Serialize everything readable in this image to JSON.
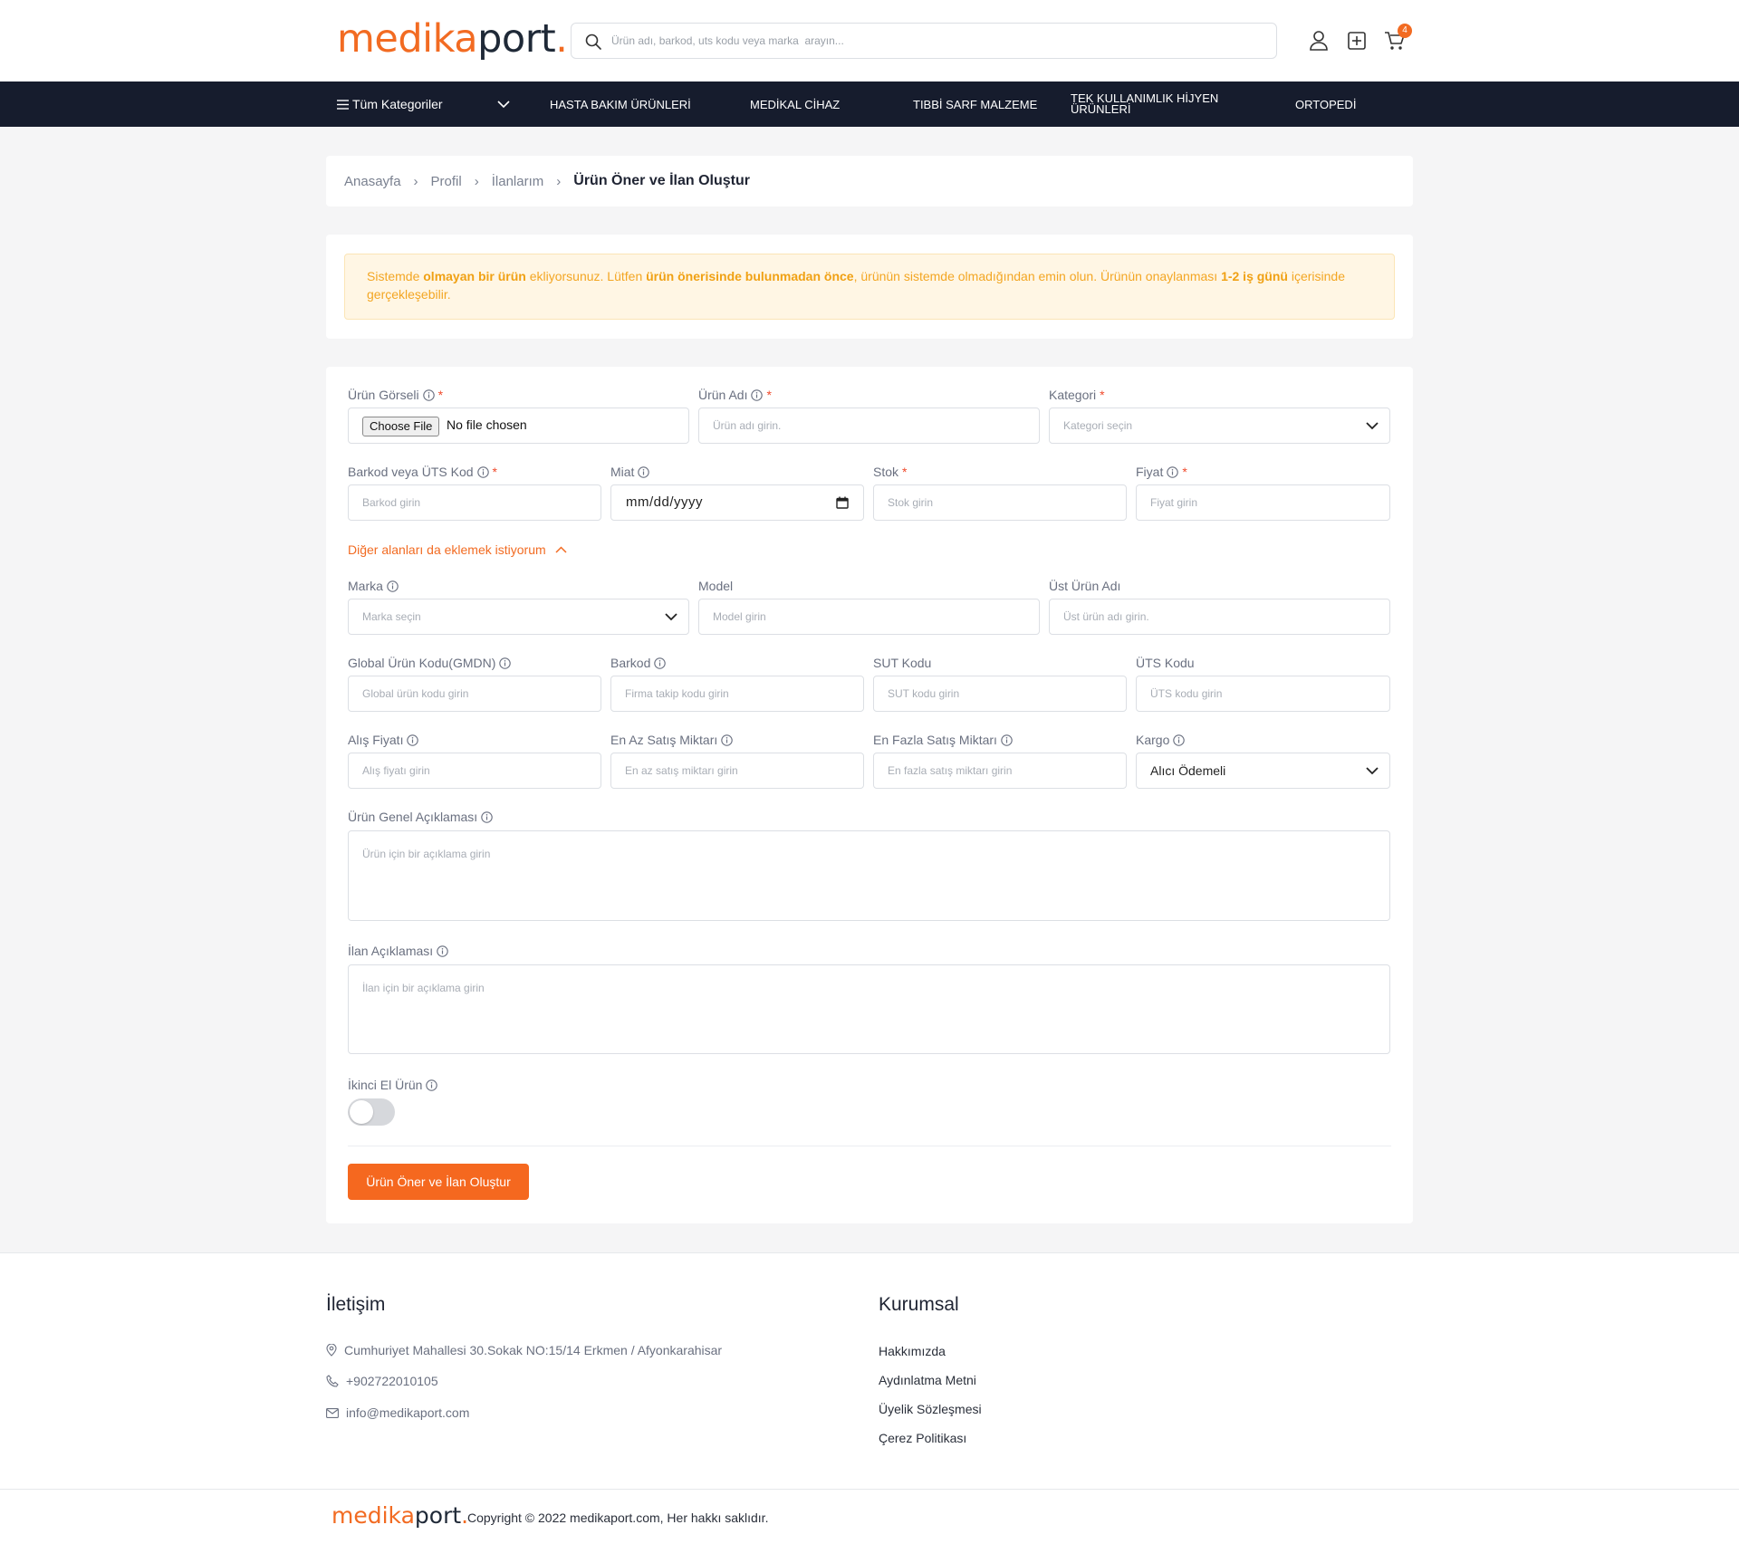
{
  "header": {
    "logo": {
      "part1": "medika",
      "part2": "port",
      "dot": "."
    },
    "search_placeholder": "Ürün adı, barkod, uts kodu veya marka  arayın...",
    "cart_count": "4"
  },
  "nav": {
    "all_categories": "Tüm Kategoriler",
    "items": [
      "HASTA BAKIM ÜRÜNLERİ",
      "MEDİKAL CİHAZ",
      "TIBBİ SARF MALZEME",
      "TEK KULLANIMLIK HİJYEN ÜRÜNLERİ",
      "ORTOPEDİ"
    ]
  },
  "breadcrumb": {
    "items": [
      "Anasayfa",
      "Profil",
      "İlanlarım"
    ],
    "current": "Ürün Öner ve İlan Oluştur"
  },
  "notice": {
    "t1": "Sistemde ",
    "b1": "olmayan bir ürün",
    "t2": " ekliyorsunuz. Lütfen ",
    "b2": "ürün önerisinde bulunmadan önce",
    "t3": ", ürünün sistemde olmadığından emin olun. Ürünün onaylanması ",
    "b3": "1-2 iş günü",
    "t4": " içerisinde gerçekleşebilir."
  },
  "form": {
    "image": {
      "label": "Ürün Görseli",
      "button": "Choose File",
      "status": "No file chosen"
    },
    "name": {
      "label": "Ürün Adı",
      "placeholder": "Ürün adı girin."
    },
    "category": {
      "label": "Kategori",
      "placeholder": "Kategori seçin"
    },
    "barcode_uts": {
      "label": "Barkod veya ÜTS Kod",
      "placeholder": "Barkod girin"
    },
    "expiry": {
      "label": "Miat",
      "value": "mm/dd/yyyy"
    },
    "stock": {
      "label": "Stok",
      "placeholder": "Stok girin"
    },
    "price": {
      "label": "Fiyat",
      "placeholder": "Fiyat girin"
    },
    "more_toggle": "Diğer alanları da eklemek istiyorum",
    "brand": {
      "label": "Marka",
      "placeholder": "Marka seçin"
    },
    "model": {
      "label": "Model",
      "placeholder": "Model girin"
    },
    "parent_name": {
      "label": "Üst Ürün Adı",
      "placeholder": "Üst ürün adı girin."
    },
    "gmdn": {
      "label": "Global Ürün Kodu(GMDN)",
      "placeholder": "Global ürün kodu girin"
    },
    "barcode": {
      "label": "Barkod",
      "placeholder": "Firma takip kodu girin"
    },
    "sut": {
      "label": "SUT Kodu",
      "placeholder": "SUT kodu girin"
    },
    "uts": {
      "label": "ÜTS Kodu",
      "placeholder": "ÜTS kodu girin"
    },
    "buy_price": {
      "label": "Alış Fiyatı",
      "placeholder": "Alış fiyatı girin"
    },
    "min_qty": {
      "label": "En Az Satış Miktarı",
      "placeholder": "En az satış miktarı girin"
    },
    "max_qty": {
      "label": "En Fazla Satış Miktarı",
      "placeholder": "En fazla satış miktarı girin"
    },
    "cargo": {
      "label": "Kargo",
      "value": "Alıcı Ödemeli"
    },
    "general_desc": {
      "label": "Ürün Genel Açıklaması",
      "placeholder": "Ürün için bir açıklama girin"
    },
    "listing_desc": {
      "label": "İlan Açıklaması",
      "placeholder": "İlan için bir açıklama girin"
    },
    "second_hand": {
      "label": "İkinci El Ürün"
    },
    "submit": "Ürün Öner ve İlan Oluştur",
    "required_mark": "*"
  },
  "footer": {
    "contact_title": "İletişim",
    "address": "Cumhuriyet Mahallesi 30.Sokak NO:15/14 Erkmen / Afyonkarahisar",
    "phone": "+902722010105",
    "email": "info@medikaport.com",
    "corporate_title": "Kurumsal",
    "links": [
      "Hakkımızda",
      "Aydınlatma Metni",
      "Üyelik Sözleşmesi",
      "Çerez Politikası"
    ],
    "copyright": "Copyright © 2022 medikaport.com, Her hakkı saklıdır."
  },
  "colors": {
    "accent": "#f26b22",
    "nav_bg": "#161c2d",
    "notice_bg": "#fff6e4",
    "notice_text": "#f3a623"
  }
}
